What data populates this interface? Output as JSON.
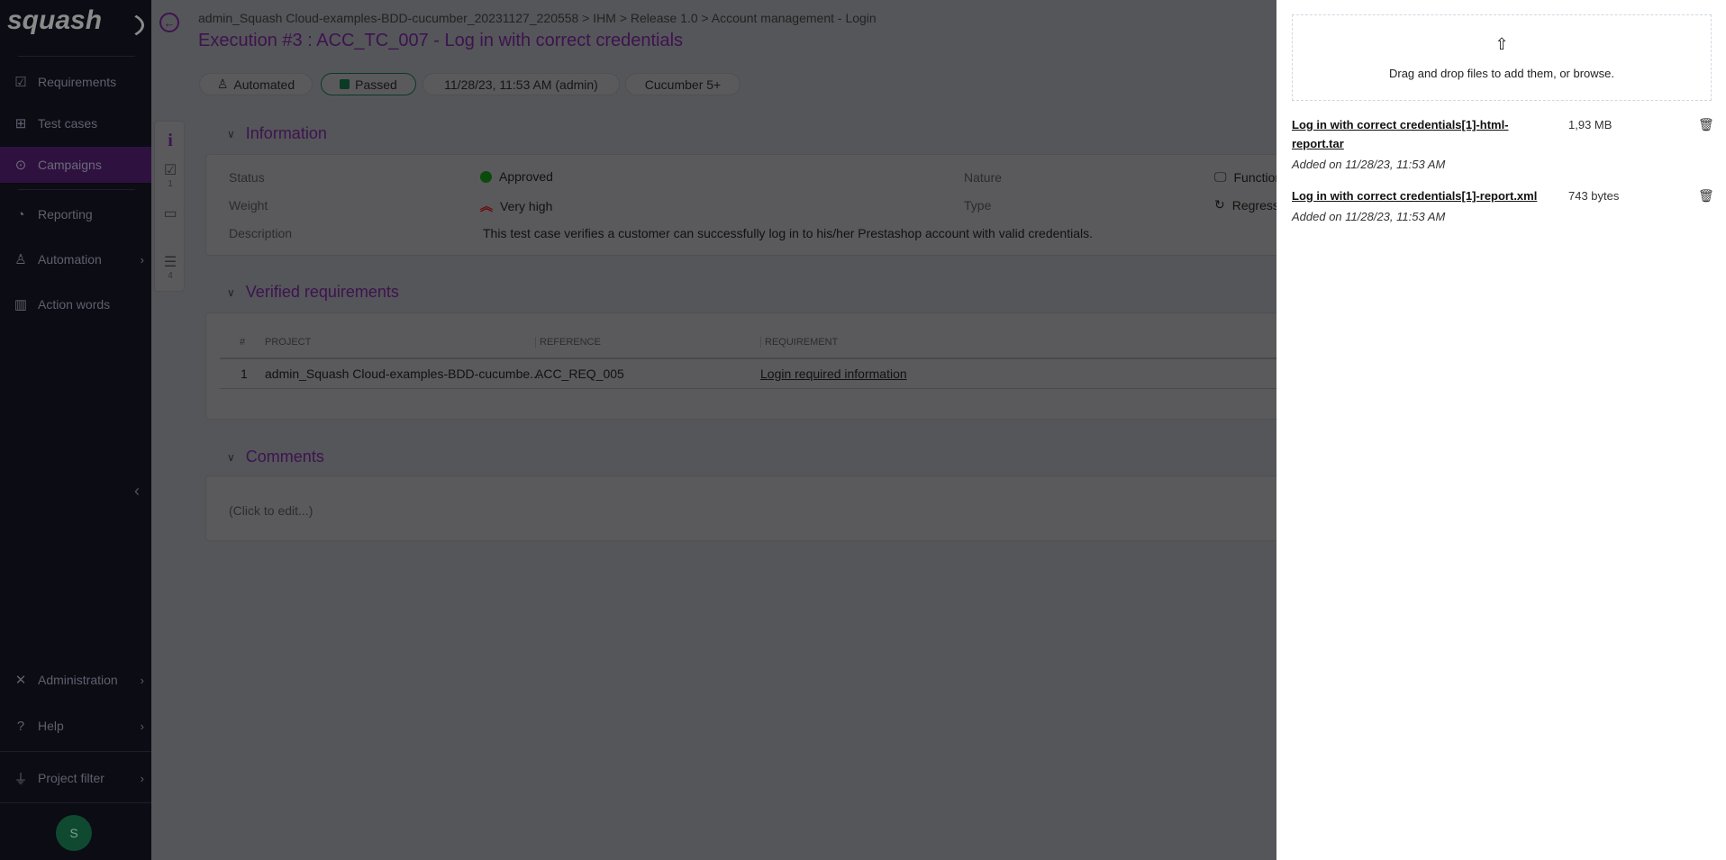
{
  "sidebar": {
    "logo": "squash",
    "items": [
      {
        "label": "Requirements",
        "icon": "checkbox-icon"
      },
      {
        "label": "Test cases",
        "icon": "tree-icon"
      },
      {
        "label": "Campaigns",
        "icon": "play-circle-icon",
        "active": true
      },
      {
        "label": "Reporting",
        "icon": "pie-icon"
      },
      {
        "label": "Automation",
        "icon": "robot-icon"
      },
      {
        "label": "Action words",
        "icon": "library-icon"
      }
    ],
    "bottom": [
      {
        "label": "Administration"
      },
      {
        "label": "Help"
      },
      {
        "label": "Project filter"
      }
    ],
    "avatar": "S"
  },
  "header": {
    "breadcrumb": "admin_Squash Cloud-examples-BDD-cucumber_20231127_220558 > IHM > Release 1.0 > Account management - Login",
    "title": "Execution #3 : ACC_TC_007 - Log in with correct credentials",
    "chips": {
      "mode": "Automated",
      "status": "Passed",
      "date": "11/28/23, 11:53 AM (admin)",
      "framework": "Cucumber 5+"
    }
  },
  "vtabs": {
    "requirements_count": "1",
    "steps_count": "4"
  },
  "information": {
    "heading": "Information",
    "status_label": "Status",
    "status": "Approved",
    "weight_label": "Weight",
    "weight": "Very high",
    "description_label": "Description",
    "description": "This test case verifies a customer can successfully log in to his/her Prestashop account with valid credentials.",
    "nature_label": "Nature",
    "nature": "Functional",
    "type_label": "Type",
    "type": "Regression"
  },
  "requirements": {
    "heading": "Verified requirements",
    "columns": [
      "#",
      "Project",
      "Reference",
      "Requirement"
    ],
    "rows": [
      {
        "num": "1",
        "project": "admin_Squash Cloud-examples-BDD-cucumbe...",
        "reference": "ACC_REQ_005",
        "requirement": "Login required information"
      }
    ]
  },
  "comments": {
    "heading": "Comments",
    "placeholder": "(Click to edit...)"
  },
  "attachments": {
    "drop_text": "Drag and drop files to add them, or browse.",
    "files": [
      {
        "name": "Log in with correct credentials[1]-html-report.tar",
        "size": "1,93 MB",
        "added": "Added on 11/28/23, 11:53 AM"
      },
      {
        "name": "Log in with correct credentials[1]-report.xml",
        "size": "743 bytes",
        "added": "Added on 11/28/23, 11:53 AM"
      }
    ]
  }
}
